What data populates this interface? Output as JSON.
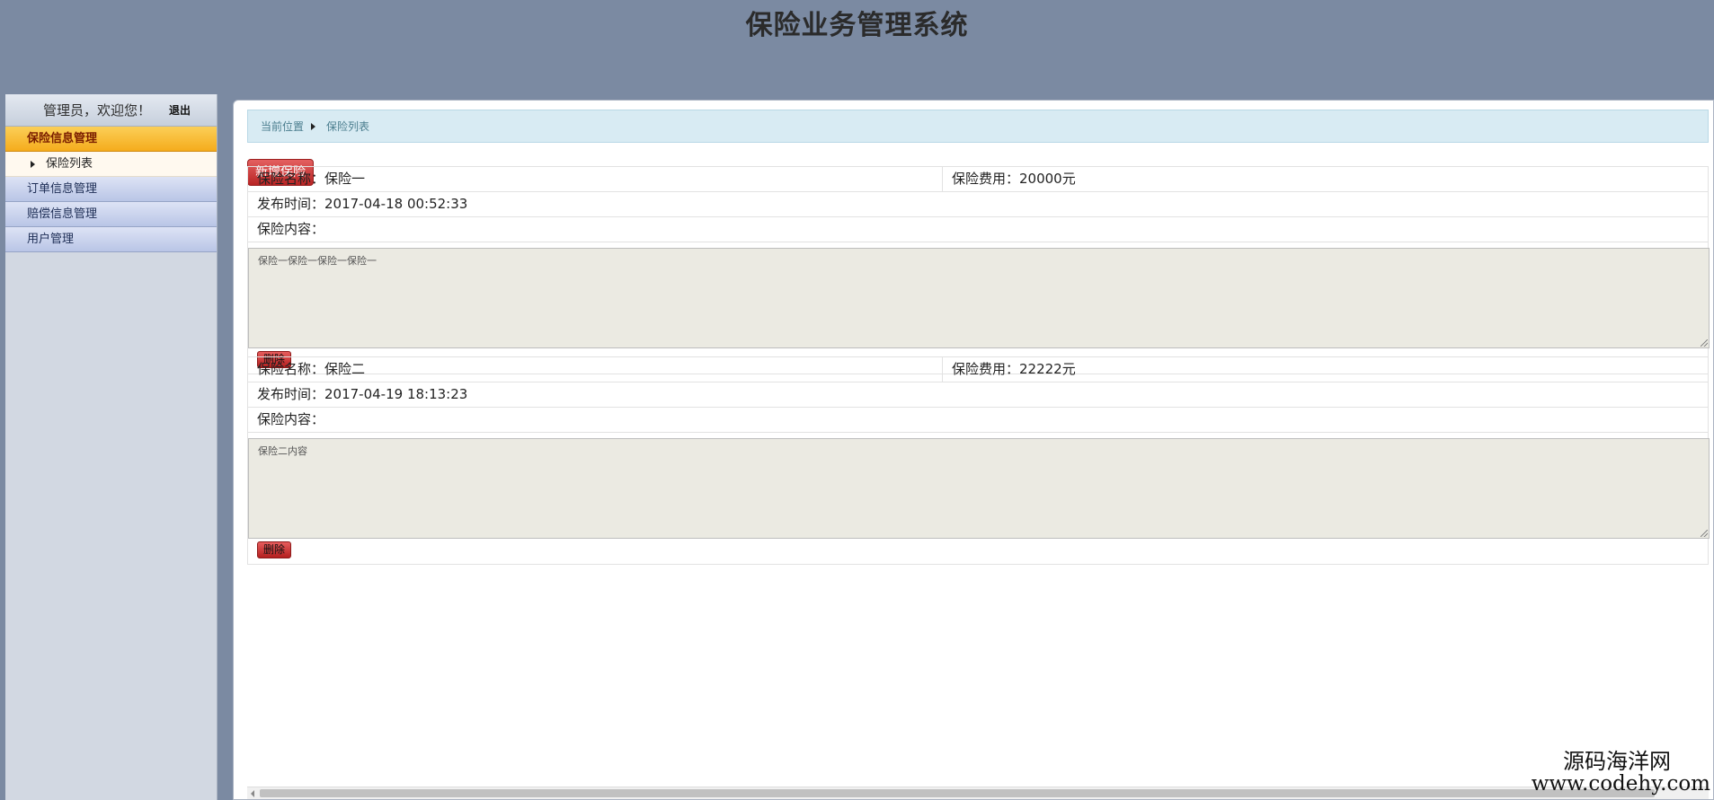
{
  "header": {
    "title": "保险业务管理系统"
  },
  "sidebar": {
    "welcome": "管理员，欢迎您！",
    "logout": "退出",
    "menu": [
      {
        "label": "保险信息管理",
        "active": true
      },
      {
        "label": "保险列表",
        "submenu": true
      },
      {
        "label": "订单信息管理"
      },
      {
        "label": "赔偿信息管理"
      },
      {
        "label": "用户管理"
      }
    ]
  },
  "breadcrumb": {
    "current": "当前位置",
    "page": "保险列表"
  },
  "toolbar": {
    "add_label": "新增保险"
  },
  "records": [
    {
      "name": "保险名称：保险一",
      "fee": "保险费用：20000元",
      "time": "发布时间：2017-04-18 00:52:33",
      "content_label": "保险内容：",
      "content": "保险一保险一保险一保险一",
      "delete_label": "删除"
    },
    {
      "name": "保险名称：保险二",
      "fee": "保险费用：22222元",
      "time": "发布时间：2017-04-19 18:13:23",
      "content_label": "保险内容：",
      "content": "保险二内容",
      "delete_label": "删除"
    }
  ],
  "watermark": {
    "cn": "源码海洋网",
    "url": "www.codehy.com"
  },
  "colors": {
    "header_bg": "#7b8aa2",
    "active_menu": "#f5ac1c",
    "button_red": "#b82424"
  }
}
